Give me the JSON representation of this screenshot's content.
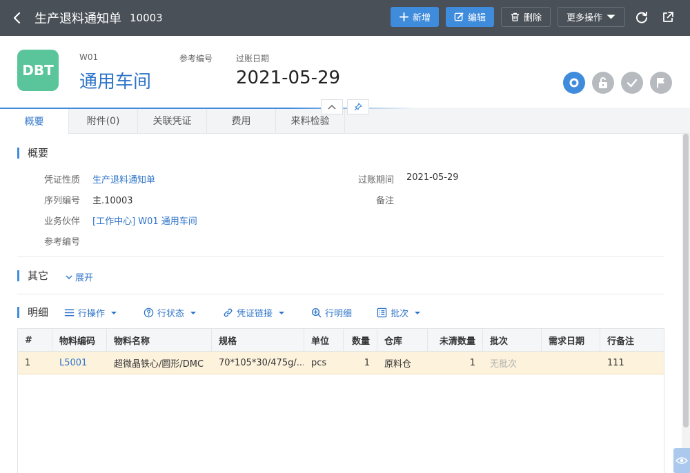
{
  "topbar": {
    "title": "生产退料通知单",
    "doc_no": "10003",
    "buttons": {
      "add": "新增",
      "edit": "编辑",
      "delete": "删除",
      "more": "更多操作"
    }
  },
  "header": {
    "avatar_text": "DBT",
    "code": "W01",
    "name": "通用车间",
    "ref_label": "参考编号",
    "date_label": "过账日期",
    "date": "2021-05-29"
  },
  "tabs": [
    {
      "label": "概要"
    },
    {
      "label": "附件(0)"
    },
    {
      "label": "关联凭证"
    },
    {
      "label": "费用"
    },
    {
      "label": "来料检验"
    }
  ],
  "summary": {
    "title": "概要",
    "fields": {
      "nature_label": "凭证性质",
      "nature_value": "生产退料通知单",
      "serial_label": "序列编号",
      "serial_value": "主.10003",
      "partner_label": "业务伙伴",
      "partner_value": "[工作中心] W01 通用车间",
      "ref_label": "参考编号",
      "period_label": "过账期间",
      "period_value": "2021-05-29",
      "remark_label": "备注"
    }
  },
  "other": {
    "title": "其它",
    "expand_label": "展开"
  },
  "detail": {
    "title": "明细",
    "tools": {
      "row_ops": "行操作",
      "row_status": "行状态",
      "doc_link": "凭证链接",
      "row_detail": "行明细",
      "batch": "批次"
    },
    "columns": [
      "#",
      "物料编码",
      "物料名称",
      "规格",
      "单位",
      "数量",
      "仓库",
      "未清数量",
      "批次",
      "需求日期",
      "行备注"
    ],
    "rows": [
      [
        "1",
        "L5001",
        "超微晶铁心/圆形/DMC",
        "70*105*30/475g/...",
        "pcs",
        "1",
        "原料仓",
        "1",
        "无批次",
        "",
        "111"
      ]
    ]
  },
  "colors": {
    "topbar": "#4a5058",
    "primary": "#3f8bdc",
    "link": "#2e74c9",
    "avatar": "#5ac49a",
    "row_highlight": "#fdf2dc"
  }
}
